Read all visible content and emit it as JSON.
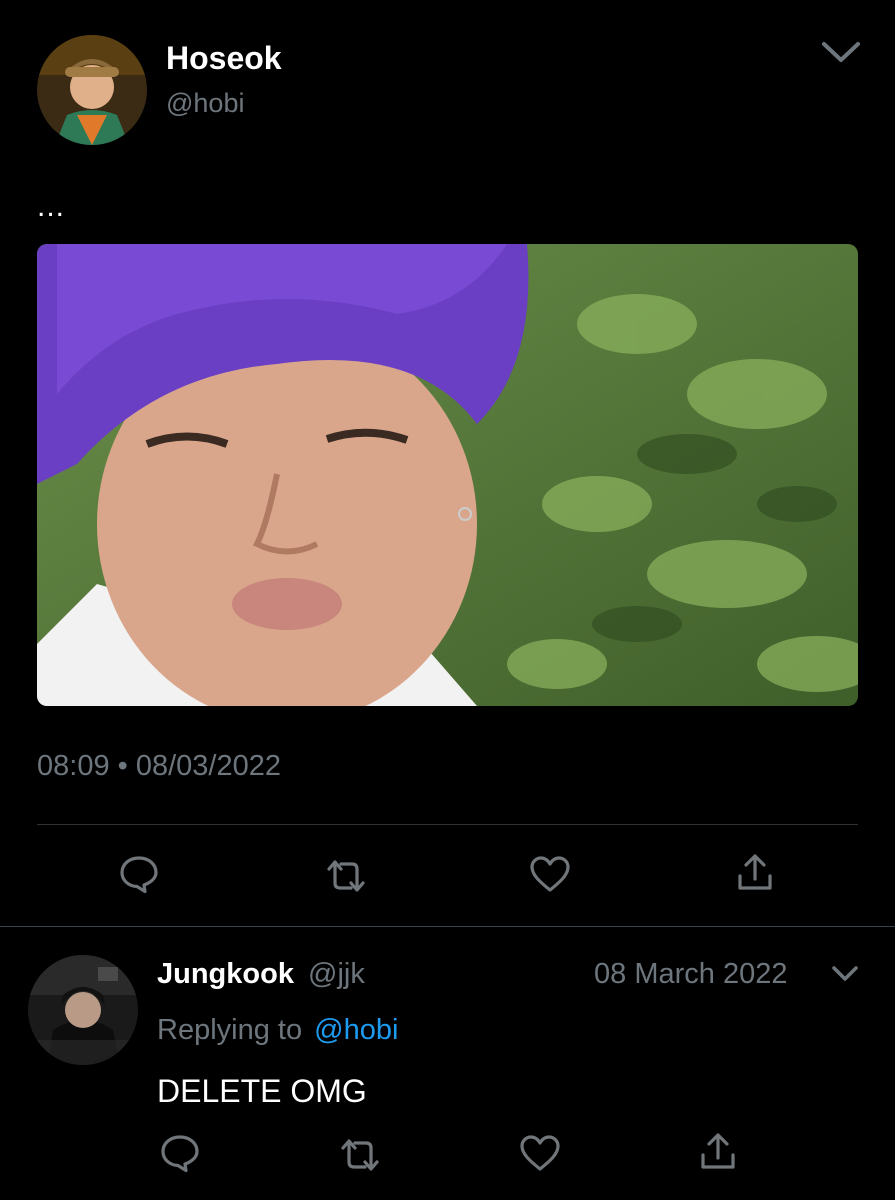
{
  "tweet": {
    "author_name": "Hoseok",
    "author_handle": "@hobi",
    "text": "...",
    "timestamp": "08:09 • 08/03/2022",
    "media_alt_icon": "photo-media"
  },
  "reply": {
    "author_name": "Jungkook",
    "author_handle": "@jjk",
    "date": "08 March 2022",
    "replying_prefix": "Replying to",
    "replying_handle": "@hobi",
    "text": "DELETE OMG"
  },
  "icons": {
    "reply": "speech-bubble-icon",
    "retweet": "retweet-icon",
    "like": "heart-icon",
    "share": "share-icon",
    "more": "chevron-down-icon"
  },
  "colors": {
    "background": "#000000",
    "muted_text": "#6e767d",
    "link": "#1d9bf0",
    "icon": "#71767b"
  }
}
